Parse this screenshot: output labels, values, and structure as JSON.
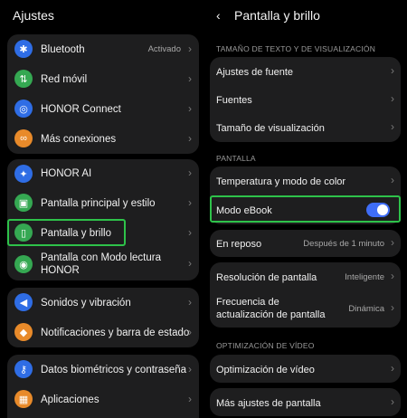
{
  "left": {
    "title": "Ajustes",
    "items": [
      {
        "label": "Bluetooth",
        "value": "Activado",
        "icon": "bluetooth-icon",
        "color": "#2f6de5"
      },
      {
        "label": "Red móvil",
        "icon": "signal-icon",
        "color": "#35a852"
      },
      {
        "label": "HONOR Connect",
        "icon": "connect-icon",
        "color": "#2f6de5"
      },
      {
        "label": "Más conexiones",
        "icon": "link-icon",
        "color": "#e88a2a"
      },
      {
        "label": "HONOR AI",
        "icon": "ai-icon",
        "color": "#2f6de5"
      },
      {
        "label": "Pantalla principal y estilo",
        "icon": "image-icon",
        "color": "#35a852"
      },
      {
        "label": "Pantalla y brillo",
        "icon": "phone-icon",
        "color": "#35a852"
      },
      {
        "label": "Pantalla con Modo lectura",
        "label2": "HONOR",
        "icon": "eye-icon",
        "color": "#35a852"
      },
      {
        "label": "Sonidos y vibración",
        "icon": "sound-icon",
        "color": "#2f6de5"
      },
      {
        "label": "Notificaciones y barra de estado",
        "icon": "bell-icon",
        "color": "#e88a2a"
      },
      {
        "label": "Datos biométricos y contraseña",
        "icon": "key-icon",
        "color": "#2f6de5"
      },
      {
        "label": "Aplicaciones",
        "icon": "apps-icon",
        "color": "#e88a2a"
      }
    ]
  },
  "right": {
    "title": "Pantalla y brillo",
    "section1": "TAMAÑO DE TEXTO Y DE VISUALIZACIÓN",
    "fuente": "Ajustes de fuente",
    "fuentes": "Fuentes",
    "tamano": "Tamaño de visualización",
    "section2": "PANTALLA",
    "temperatura": "Temperatura y modo de color",
    "ebook": "Modo eBook",
    "ebook_on": true,
    "reposo": "En reposo",
    "reposo_value": "Después de 1 minuto",
    "resolucion": "Resolución de pantalla",
    "resolucion_value": "Inteligente",
    "frecuencia1": "Frecuencia de",
    "frecuencia2": "actualización de pantalla",
    "frecuencia_value": "Dinámica",
    "section3": "OPTIMIZACIÓN DE VÍDEO",
    "video": "Optimización de vídeo",
    "mas": "Más ajustes de pantalla"
  },
  "colors": {
    "highlight": "#2ec24a",
    "toggle": "#3f6df6"
  }
}
